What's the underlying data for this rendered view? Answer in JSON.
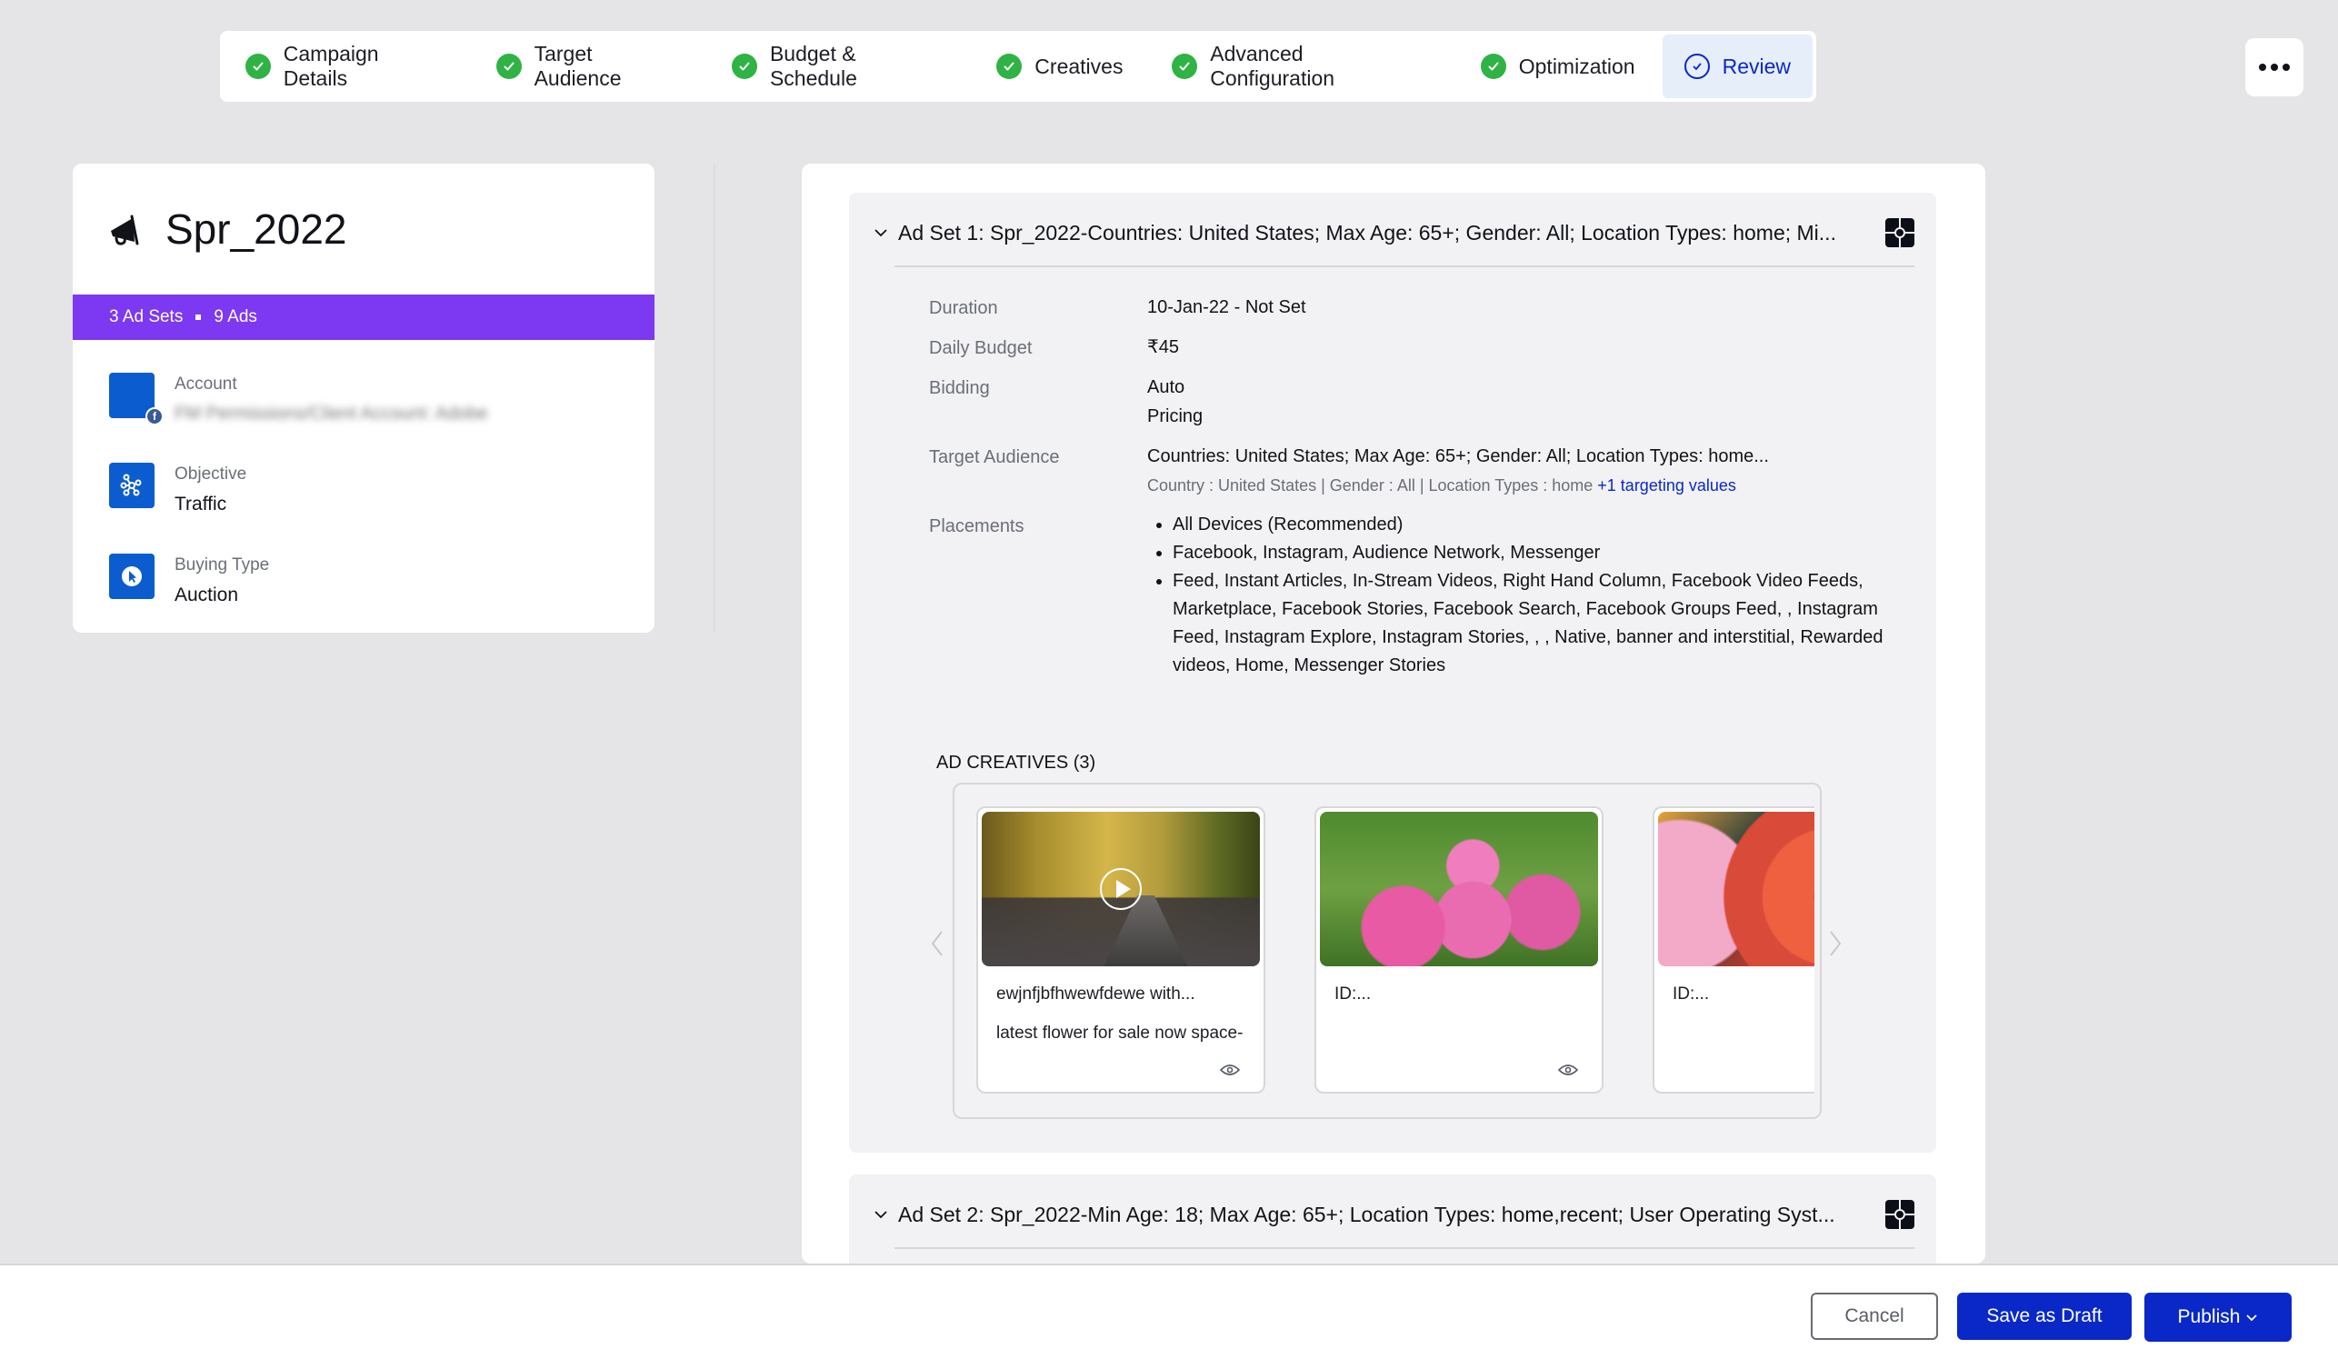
{
  "stepper": {
    "steps": [
      {
        "label": "Campaign Details",
        "status": "complete"
      },
      {
        "label": "Target Audience",
        "status": "complete"
      },
      {
        "label": "Budget & Schedule",
        "status": "complete"
      },
      {
        "label": "Creatives",
        "status": "complete"
      },
      {
        "label": "Advanced Configuration",
        "status": "complete"
      },
      {
        "label": "Optimization",
        "status": "complete"
      },
      {
        "label": "Review",
        "status": "active"
      }
    ],
    "more_icon": "ellipsis-icon"
  },
  "summary": {
    "icon": "megaphone-icon",
    "campaign_name": "Spr_2022",
    "ad_sets": "3 Ad Sets",
    "ads": "9 Ads",
    "account_label": "Account",
    "account_value": "FM Permissions/Client Account: Adobe",
    "objective_label": "Objective",
    "objective_value": "Traffic",
    "buying_type_label": "Buying Type",
    "buying_type_value": "Auction"
  },
  "adsets": [
    {
      "title": "Ad Set 1: Spr_2022-Countries: United States; Max Age: 65+; Gender: All; Location Types: home; Mi...",
      "details": {
        "duration_label": "Duration",
        "duration_value": "10-Jan-22 - Not Set",
        "daily_budget_label": "Daily Budget",
        "daily_budget_value": "₹45",
        "bidding_label": "Bidding",
        "bidding_value_1": "Auto",
        "bidding_value_2": "Pricing",
        "target_audience_label": "Target Audience",
        "target_audience_value": "Countries: United States; Max Age: 65+; Gender: All; Location Types: home...",
        "target_audience_sub": "Country : United States | Gender : All | Location Types : home ",
        "target_audience_link": "+1 targeting values",
        "placements_label": "Placements",
        "placements": [
          "All Devices (Recommended)",
          "Facebook, Instagram, Audience Network, Messenger",
          "Feed, Instant Articles, In-Stream Videos, Right Hand Column, Facebook Video Feeds, Marketplace, Facebook Stories, Facebook Search, Facebook Groups Feed, , Instagram Feed, Instagram Explore, Instagram Stories, , , Native, banner and interstitial, Rewarded videos, Home, Messenger Stories"
        ]
      },
      "creatives_title": "AD CREATIVES (3)",
      "creatives": [
        {
          "title": "ewjnfjbfhwewfdewe with...",
          "text": "latest flower for sale now space-",
          "media": "video"
        },
        {
          "title": "ID:...",
          "text": "",
          "media": "image"
        },
        {
          "title": "ID:...",
          "text": "",
          "media": "image"
        }
      ]
    },
    {
      "title": "Ad Set 2: Spr_2022-Min Age: 18; Max Age: 65+; Location Types: home,recent; User Operating Syst..."
    }
  ],
  "footer": {
    "cancel": "Cancel",
    "save_draft": "Save as Draft",
    "publish": "Publish"
  },
  "colors": {
    "primary": "#0a28c8",
    "success": "#2fb344",
    "band": "#7d38f2",
    "icon_badge": "#0b5cce"
  }
}
